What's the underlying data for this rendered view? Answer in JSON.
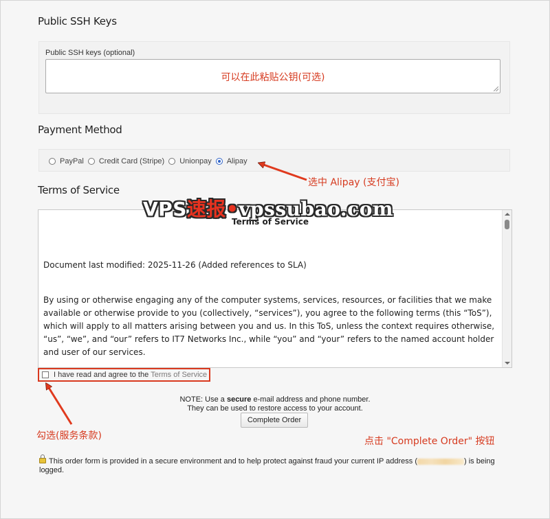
{
  "ssh": {
    "title": "Public SSH Keys",
    "label": "Public SSH keys (optional)",
    "annotation": "可以在此粘贴公钥(可选)"
  },
  "payment": {
    "title": "Payment Method",
    "options": [
      "PayPal",
      "Credit Card (Stripe)",
      "Unionpay",
      "Alipay"
    ],
    "selected": "Alipay"
  },
  "tos": {
    "title": "Terms of Service",
    "heading": "Terms of Service",
    "paragraph1": "Document last modified: 2025-11-26 (Added references to SLA)",
    "paragraph2": "By using or otherwise engaging any of the computer systems, services, resources, or facilities that we make available or otherwise provide to you (collectively, “services”), you agree to the following terms (this “ToS”), which will apply to all matters arising between you and us. In this ToS, unless the context requires otherwise, “us”, “we”, and “our” refers to IT7 Networks Inc., while “you” and “your” refers to the named account holder and user of our services.",
    "agree_text": "I have read and agree to the",
    "agree_link": "Terms of Service"
  },
  "order": {
    "note_prefix": "NOTE: Use a",
    "note_bold": "secure",
    "note_suffix": "e-mail address and phone number.",
    "note_line2": "They can be used to restore access to your account.",
    "button": "Complete Order"
  },
  "secure_notice": {
    "before": "This order form is provided in a secure environment and to help protect against fraud your current IP address (",
    "after": ") is being logged."
  },
  "annotations": {
    "alipay": "选中 Alipay (支付宝)",
    "tos": "勾选(服务条款)",
    "order": "点击 \"Complete Order\" 按钮"
  },
  "watermark": {
    "part1": "VPS",
    "part2": "速报",
    "dot": "•",
    "part3": "vpssubao.com"
  },
  "colors": {
    "annotation": "#d63a1f",
    "radio_selected": "#2f63c7"
  }
}
